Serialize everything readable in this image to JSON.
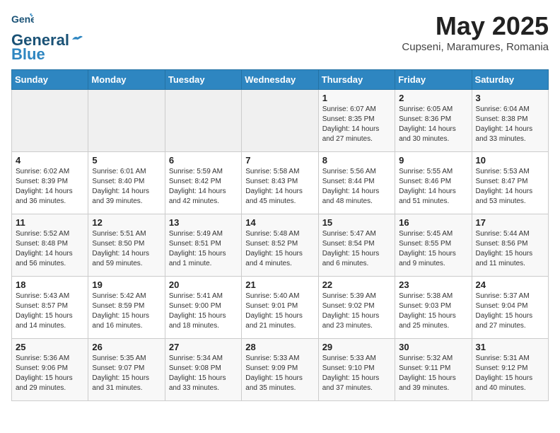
{
  "header": {
    "logo_line1": "General",
    "logo_line2": "Blue",
    "month": "May 2025",
    "location": "Cupseni, Maramures, Romania"
  },
  "days_of_week": [
    "Sunday",
    "Monday",
    "Tuesday",
    "Wednesday",
    "Thursday",
    "Friday",
    "Saturday"
  ],
  "weeks": [
    [
      {
        "day": "",
        "info": ""
      },
      {
        "day": "",
        "info": ""
      },
      {
        "day": "",
        "info": ""
      },
      {
        "day": "",
        "info": ""
      },
      {
        "day": "1",
        "info": "Sunrise: 6:07 AM\nSunset: 8:35 PM\nDaylight: 14 hours\nand 27 minutes."
      },
      {
        "day": "2",
        "info": "Sunrise: 6:05 AM\nSunset: 8:36 PM\nDaylight: 14 hours\nand 30 minutes."
      },
      {
        "day": "3",
        "info": "Sunrise: 6:04 AM\nSunset: 8:38 PM\nDaylight: 14 hours\nand 33 minutes."
      }
    ],
    [
      {
        "day": "4",
        "info": "Sunrise: 6:02 AM\nSunset: 8:39 PM\nDaylight: 14 hours\nand 36 minutes."
      },
      {
        "day": "5",
        "info": "Sunrise: 6:01 AM\nSunset: 8:40 PM\nDaylight: 14 hours\nand 39 minutes."
      },
      {
        "day": "6",
        "info": "Sunrise: 5:59 AM\nSunset: 8:42 PM\nDaylight: 14 hours\nand 42 minutes."
      },
      {
        "day": "7",
        "info": "Sunrise: 5:58 AM\nSunset: 8:43 PM\nDaylight: 14 hours\nand 45 minutes."
      },
      {
        "day": "8",
        "info": "Sunrise: 5:56 AM\nSunset: 8:44 PM\nDaylight: 14 hours\nand 48 minutes."
      },
      {
        "day": "9",
        "info": "Sunrise: 5:55 AM\nSunset: 8:46 PM\nDaylight: 14 hours\nand 51 minutes."
      },
      {
        "day": "10",
        "info": "Sunrise: 5:53 AM\nSunset: 8:47 PM\nDaylight: 14 hours\nand 53 minutes."
      }
    ],
    [
      {
        "day": "11",
        "info": "Sunrise: 5:52 AM\nSunset: 8:48 PM\nDaylight: 14 hours\nand 56 minutes."
      },
      {
        "day": "12",
        "info": "Sunrise: 5:51 AM\nSunset: 8:50 PM\nDaylight: 14 hours\nand 59 minutes."
      },
      {
        "day": "13",
        "info": "Sunrise: 5:49 AM\nSunset: 8:51 PM\nDaylight: 15 hours\nand 1 minute."
      },
      {
        "day": "14",
        "info": "Sunrise: 5:48 AM\nSunset: 8:52 PM\nDaylight: 15 hours\nand 4 minutes."
      },
      {
        "day": "15",
        "info": "Sunrise: 5:47 AM\nSunset: 8:54 PM\nDaylight: 15 hours\nand 6 minutes."
      },
      {
        "day": "16",
        "info": "Sunrise: 5:45 AM\nSunset: 8:55 PM\nDaylight: 15 hours\nand 9 minutes."
      },
      {
        "day": "17",
        "info": "Sunrise: 5:44 AM\nSunset: 8:56 PM\nDaylight: 15 hours\nand 11 minutes."
      }
    ],
    [
      {
        "day": "18",
        "info": "Sunrise: 5:43 AM\nSunset: 8:57 PM\nDaylight: 15 hours\nand 14 minutes."
      },
      {
        "day": "19",
        "info": "Sunrise: 5:42 AM\nSunset: 8:59 PM\nDaylight: 15 hours\nand 16 minutes."
      },
      {
        "day": "20",
        "info": "Sunrise: 5:41 AM\nSunset: 9:00 PM\nDaylight: 15 hours\nand 18 minutes."
      },
      {
        "day": "21",
        "info": "Sunrise: 5:40 AM\nSunset: 9:01 PM\nDaylight: 15 hours\nand 21 minutes."
      },
      {
        "day": "22",
        "info": "Sunrise: 5:39 AM\nSunset: 9:02 PM\nDaylight: 15 hours\nand 23 minutes."
      },
      {
        "day": "23",
        "info": "Sunrise: 5:38 AM\nSunset: 9:03 PM\nDaylight: 15 hours\nand 25 minutes."
      },
      {
        "day": "24",
        "info": "Sunrise: 5:37 AM\nSunset: 9:04 PM\nDaylight: 15 hours\nand 27 minutes."
      }
    ],
    [
      {
        "day": "25",
        "info": "Sunrise: 5:36 AM\nSunset: 9:06 PM\nDaylight: 15 hours\nand 29 minutes."
      },
      {
        "day": "26",
        "info": "Sunrise: 5:35 AM\nSunset: 9:07 PM\nDaylight: 15 hours\nand 31 minutes."
      },
      {
        "day": "27",
        "info": "Sunrise: 5:34 AM\nSunset: 9:08 PM\nDaylight: 15 hours\nand 33 minutes."
      },
      {
        "day": "28",
        "info": "Sunrise: 5:33 AM\nSunset: 9:09 PM\nDaylight: 15 hours\nand 35 minutes."
      },
      {
        "day": "29",
        "info": "Sunrise: 5:33 AM\nSunset: 9:10 PM\nDaylight: 15 hours\nand 37 minutes."
      },
      {
        "day": "30",
        "info": "Sunrise: 5:32 AM\nSunset: 9:11 PM\nDaylight: 15 hours\nand 39 minutes."
      },
      {
        "day": "31",
        "info": "Sunrise: 5:31 AM\nSunset: 9:12 PM\nDaylight: 15 hours\nand 40 minutes."
      }
    ]
  ]
}
